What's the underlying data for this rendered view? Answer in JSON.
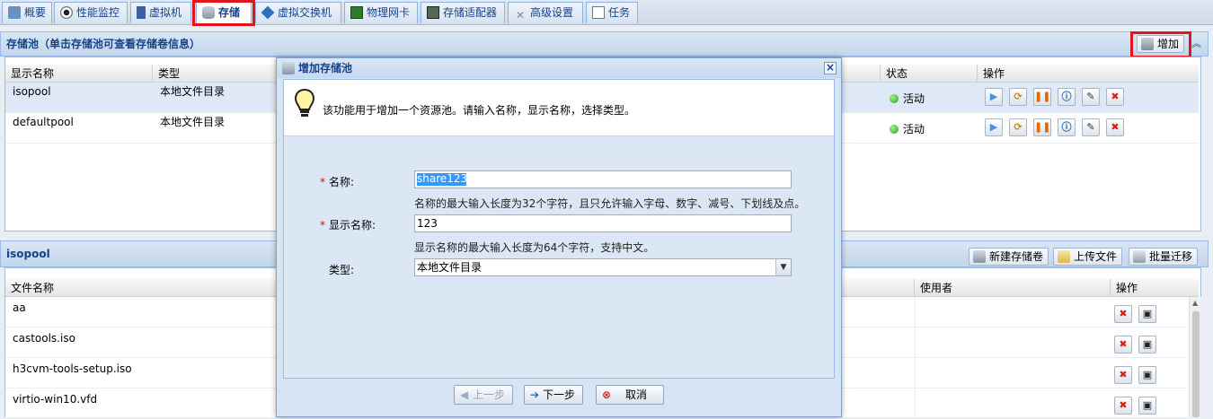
{
  "tabs": [
    {
      "label": "概要",
      "icon": "overview-icon"
    },
    {
      "label": "性能监控",
      "icon": "eye-icon"
    },
    {
      "label": "虚拟机",
      "icon": "vm-icon"
    },
    {
      "label": "存储",
      "icon": "storage-icon",
      "active": true
    },
    {
      "label": "虚拟交换机",
      "icon": "switch-icon"
    },
    {
      "label": "物理网卡",
      "icon": "nic-icon"
    },
    {
      "label": "存储适配器",
      "icon": "adapter-icon"
    },
    {
      "label": "高级设置",
      "icon": "tools-icon"
    },
    {
      "label": "任务",
      "icon": "task-icon"
    }
  ],
  "pool_panel": {
    "title": "存储池（单击存储池可查看存储卷信息）",
    "add_label": "增加",
    "columns": {
      "display_name": "显示名称",
      "type": "类型",
      "status": "状态",
      "ops": "操作"
    },
    "rows": [
      {
        "name": "isopool",
        "type": "本地文件目录",
        "status": "活动"
      },
      {
        "name": "defaultpool",
        "type": "本地文件目录",
        "status": "活动"
      }
    ]
  },
  "volume_panel": {
    "title": "isopool",
    "new_volume_label": "新建存储卷",
    "upload_label": "上传文件",
    "migrate_label": "批量迁移",
    "columns": {
      "file_name": "文件名称",
      "user": "使用者",
      "ops": "操作"
    },
    "rows": [
      {
        "name": "aa"
      },
      {
        "name": "castools.iso"
      },
      {
        "name": "h3cvm-tools-setup.iso"
      },
      {
        "name": "virtio-win10.vfd"
      }
    ]
  },
  "dialog": {
    "title": "增加存储池",
    "tip": "该功能用于增加一个资源池。请输入名称，显示名称，选择类型。",
    "name_label": "名称:",
    "name_value": "share123",
    "name_hint": "名称的最大输入长度为32个字符，且只允许输入字母、数字、减号、下划线及点。",
    "display_label": "显示名称:",
    "display_value": "123",
    "display_hint": "显示名称的最大输入长度为64个字符，支持中文。",
    "type_label": "类型:",
    "type_value": "本地文件目录",
    "prev_label": "上一步",
    "next_label": "下一步",
    "cancel_label": "取消"
  },
  "colors": {
    "accent": "#15428b",
    "highlight": "#e3141b",
    "status_active": "#23a31a"
  }
}
